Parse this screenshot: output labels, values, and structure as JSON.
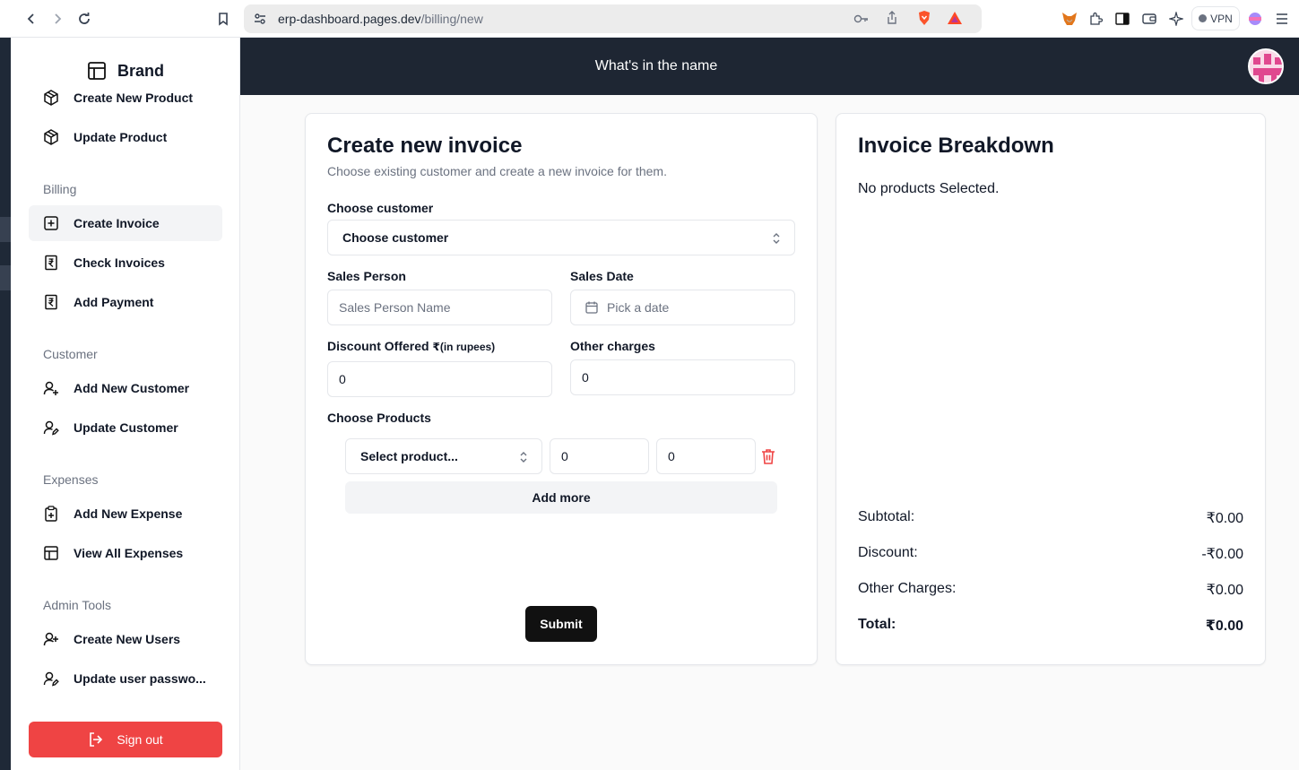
{
  "browser": {
    "url_host": "erp-dashboard.pages.dev",
    "url_path": "/billing/new",
    "vpn_label": "VPN"
  },
  "sidebar": {
    "brand": "Brand",
    "items_top": [
      {
        "label": "Create New Product",
        "icon": "package-icon"
      },
      {
        "label": "Update Product",
        "icon": "package-icon"
      }
    ],
    "sections": [
      {
        "title": "Billing",
        "items": [
          {
            "label": "Create Invoice",
            "icon": "plus-square-icon",
            "active": true
          },
          {
            "label": "Check Invoices",
            "icon": "receipt-icon"
          },
          {
            "label": "Add Payment",
            "icon": "receipt-icon"
          }
        ]
      },
      {
        "title": "Customer",
        "items": [
          {
            "label": "Add New Customer",
            "icon": "user-plus-icon"
          },
          {
            "label": "Update Customer",
            "icon": "user-pen-icon"
          }
        ]
      },
      {
        "title": "Expenses",
        "items": [
          {
            "label": "Add New Expense",
            "icon": "clipboard-plus-icon"
          },
          {
            "label": "View All Expenses",
            "icon": "table-icon"
          }
        ]
      },
      {
        "title": "Admin Tools",
        "items": [
          {
            "label": "Create New Users",
            "icon": "user-plus-icon"
          },
          {
            "label": "Update user passwo...",
            "icon": "user-pen-icon"
          }
        ]
      }
    ],
    "signout_label": "Sign out"
  },
  "header": {
    "title": "What's in the name"
  },
  "invoice_form": {
    "title": "Create new invoice",
    "subtitle": "Choose existing customer and create a new invoice for them.",
    "customer_label": "Choose customer",
    "customer_value": "Choose customer",
    "sales_person_label": "Sales Person",
    "sales_person_placeholder": "Sales Person Name",
    "sales_date_label": "Sales Date",
    "sales_date_placeholder": "Pick a date",
    "discount_label": "Discount Offered",
    "discount_unit": "₹(in rupees)",
    "discount_value": "0",
    "other_charges_label": "Other charges",
    "other_charges_value": "0",
    "products_label": "Choose Products",
    "product_rows": [
      {
        "product": "Select product...",
        "qty": "0",
        "price": "0"
      }
    ],
    "add_more_label": "Add more",
    "submit_label": "Submit"
  },
  "breakdown": {
    "title": "Invoice Breakdown",
    "empty_text": "No products Selected.",
    "subtotal_label": "Subtotal:",
    "subtotal_value": "₹0.00",
    "discount_label": "Discount:",
    "discount_value": "-₹0.00",
    "other_label": "Other Charges:",
    "other_value": "₹0.00",
    "total_label": "Total:",
    "total_value": "₹0.00"
  },
  "colors": {
    "header_bg": "#1e2633",
    "danger": "#ef4444",
    "submit_bg": "#111111"
  }
}
